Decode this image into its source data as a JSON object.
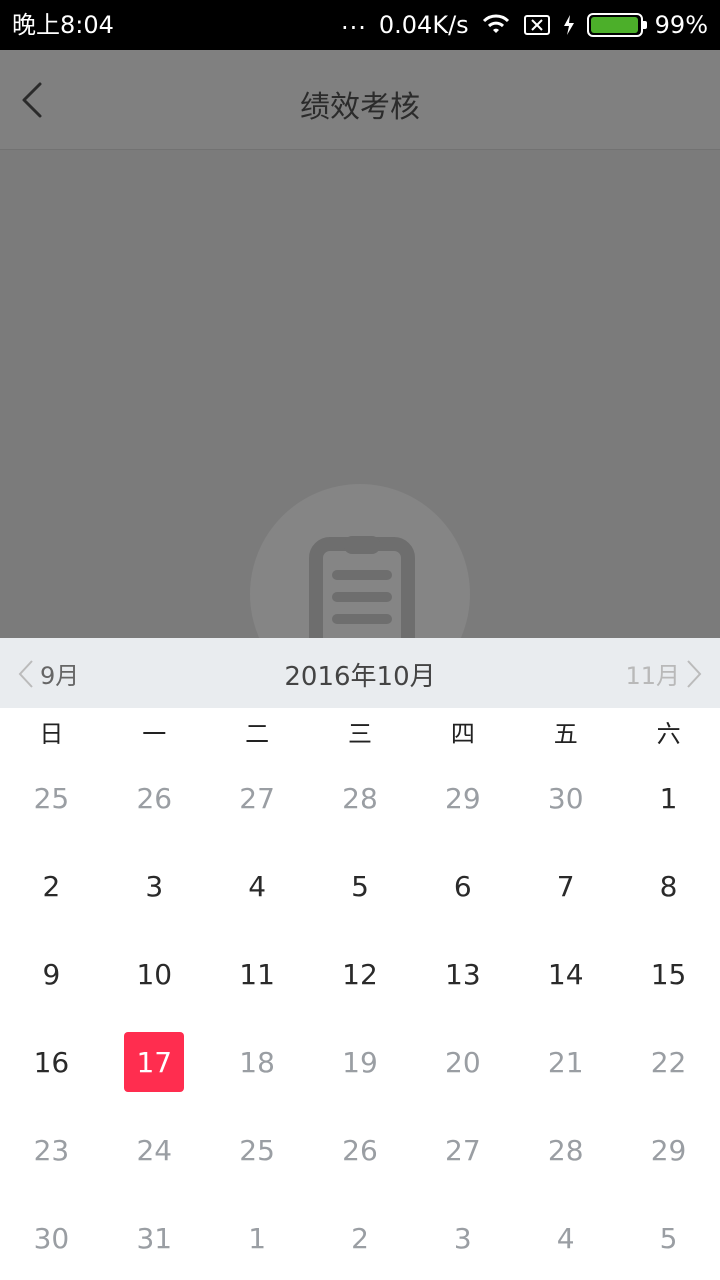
{
  "status": {
    "time": "晚上8:04",
    "dots": "...",
    "speed": "0.04K/s",
    "battery": "99%",
    "battery_level": 0.99
  },
  "header": {
    "title": "绩效考核",
    "back_icon": "back-arrow-icon"
  },
  "calendar": {
    "prev_label": "9月",
    "current_label": "2016年10月",
    "next_label": "11月",
    "weekdays": [
      "日",
      "一",
      "二",
      "三",
      "四",
      "五",
      "六"
    ],
    "selected_color": "#ff2d4f",
    "days": [
      {
        "label": "25",
        "state": "muted"
      },
      {
        "label": "26",
        "state": "muted"
      },
      {
        "label": "27",
        "state": "muted"
      },
      {
        "label": "28",
        "state": "muted"
      },
      {
        "label": "29",
        "state": "muted"
      },
      {
        "label": "30",
        "state": "muted"
      },
      {
        "label": "1",
        "state": "normal"
      },
      {
        "label": "2",
        "state": "normal"
      },
      {
        "label": "3",
        "state": "normal"
      },
      {
        "label": "4",
        "state": "normal"
      },
      {
        "label": "5",
        "state": "normal"
      },
      {
        "label": "6",
        "state": "normal"
      },
      {
        "label": "7",
        "state": "normal"
      },
      {
        "label": "8",
        "state": "normal"
      },
      {
        "label": "9",
        "state": "normal"
      },
      {
        "label": "10",
        "state": "normal"
      },
      {
        "label": "11",
        "state": "normal"
      },
      {
        "label": "12",
        "state": "normal"
      },
      {
        "label": "13",
        "state": "normal"
      },
      {
        "label": "14",
        "state": "normal"
      },
      {
        "label": "15",
        "state": "normal"
      },
      {
        "label": "16",
        "state": "normal"
      },
      {
        "label": "17",
        "state": "selected"
      },
      {
        "label": "18",
        "state": "muted"
      },
      {
        "label": "19",
        "state": "muted"
      },
      {
        "label": "20",
        "state": "muted"
      },
      {
        "label": "21",
        "state": "muted"
      },
      {
        "label": "22",
        "state": "muted"
      },
      {
        "label": "23",
        "state": "muted"
      },
      {
        "label": "24",
        "state": "muted"
      },
      {
        "label": "25",
        "state": "muted"
      },
      {
        "label": "26",
        "state": "muted"
      },
      {
        "label": "27",
        "state": "muted"
      },
      {
        "label": "28",
        "state": "muted"
      },
      {
        "label": "29",
        "state": "muted"
      },
      {
        "label": "30",
        "state": "muted"
      },
      {
        "label": "31",
        "state": "muted"
      },
      {
        "label": "1",
        "state": "muted"
      },
      {
        "label": "2",
        "state": "muted"
      },
      {
        "label": "3",
        "state": "muted"
      },
      {
        "label": "4",
        "state": "muted"
      },
      {
        "label": "5",
        "state": "muted"
      }
    ]
  }
}
